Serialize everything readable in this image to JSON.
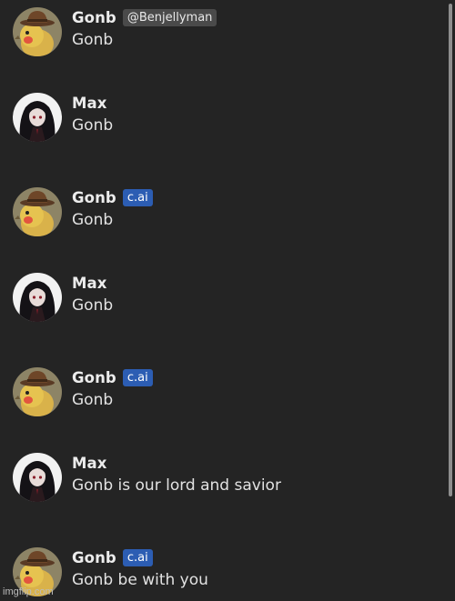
{
  "messages": [
    {
      "name": "Gonb",
      "tag": "@Benjellyman",
      "tag_type": "handle",
      "text": "Gonb",
      "avatar": "bird-with-hat-avatar"
    },
    {
      "name": "Max",
      "tag": "",
      "tag_type": "none",
      "text": "Gonb",
      "avatar": "dark-haired-girl-avatar"
    },
    {
      "name": "Gonb",
      "tag": "c.ai",
      "tag_type": "cai",
      "text": "Gonb",
      "avatar": "bird-with-hat-avatar"
    },
    {
      "name": "Max",
      "tag": "",
      "tag_type": "none",
      "text": "Gonb",
      "avatar": "dark-haired-girl-avatar"
    },
    {
      "name": "Gonb",
      "tag": "c.ai",
      "tag_type": "cai",
      "text": "Gonb",
      "avatar": "bird-with-hat-avatar"
    },
    {
      "name": "Max",
      "tag": "",
      "tag_type": "none",
      "text": "Gonb is our lord and savior",
      "avatar": "dark-haired-girl-avatar"
    },
    {
      "name": "Gonb",
      "tag": "c.ai",
      "tag_type": "cai",
      "text": "Gonb be with you",
      "avatar": "bird-with-hat-avatar"
    }
  ],
  "watermark": "imgflip.com",
  "colors": {
    "background": "#242424",
    "cai_badge": "#2c5db3",
    "handle_badge": "#4a4a4a"
  }
}
